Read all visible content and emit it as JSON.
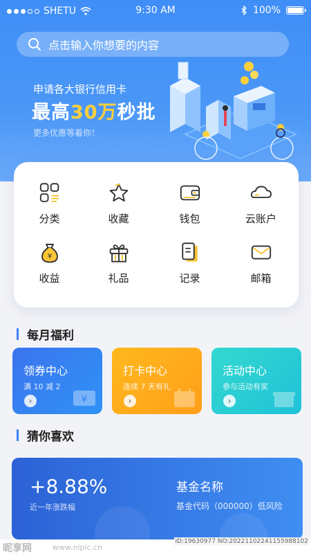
{
  "status_bar": {
    "carrier": "SHETU",
    "time": "9:30 AM",
    "battery": "100%"
  },
  "search": {
    "placeholder": "点击输入你想要的内容"
  },
  "banner": {
    "subtitle": "申请各大银行信用卡",
    "headline_pre": "最高",
    "headline_highlight": "30万",
    "headline_post": "秒批",
    "more": "更多优惠等着你！"
  },
  "grid": [
    {
      "label": "分类",
      "icon": "category-icon"
    },
    {
      "label": "收藏",
      "icon": "star-icon"
    },
    {
      "label": "钱包",
      "icon": "wallet-icon"
    },
    {
      "label": "云账户",
      "icon": "cloud-icon"
    },
    {
      "label": "收益",
      "icon": "money-bag-icon"
    },
    {
      "label": "礼品",
      "icon": "gift-icon"
    },
    {
      "label": "记录",
      "icon": "record-icon"
    },
    {
      "label": "邮箱",
      "icon": "mail-icon"
    }
  ],
  "monthly": {
    "title": "每月福利",
    "cards": [
      {
        "title": "领券中心",
        "subtitle": "满 10 减 2",
        "color_from": "#3a7cf0",
        "color_to": "#2f8ff5"
      },
      {
        "title": "打卡中心",
        "subtitle": "连续 7 天有礼",
        "color_from": "#ffb21c",
        "color_to": "#ffa01a"
      },
      {
        "title": "活动中心",
        "subtitle": "参与活动有奖",
        "color_from": "#2ed4cf",
        "color_to": "#22c5d6"
      }
    ]
  },
  "guess": {
    "title": "猜你喜欢",
    "fund": {
      "rate": "+8.88%",
      "rate_label": "近一年涨跌幅",
      "name": "基金名称",
      "code": "基金代码（000000）低风险"
    }
  },
  "watermark": {
    "logo": "昵享网",
    "url": "www.nipic.cn",
    "id": "ID:19630977 NO:20221102241155988102"
  },
  "colors": {
    "primary": "#3f8ef7",
    "accent": "#ffcf3a",
    "icon_stroke": "#2b2b2b",
    "icon_fill": "#f9c437"
  }
}
